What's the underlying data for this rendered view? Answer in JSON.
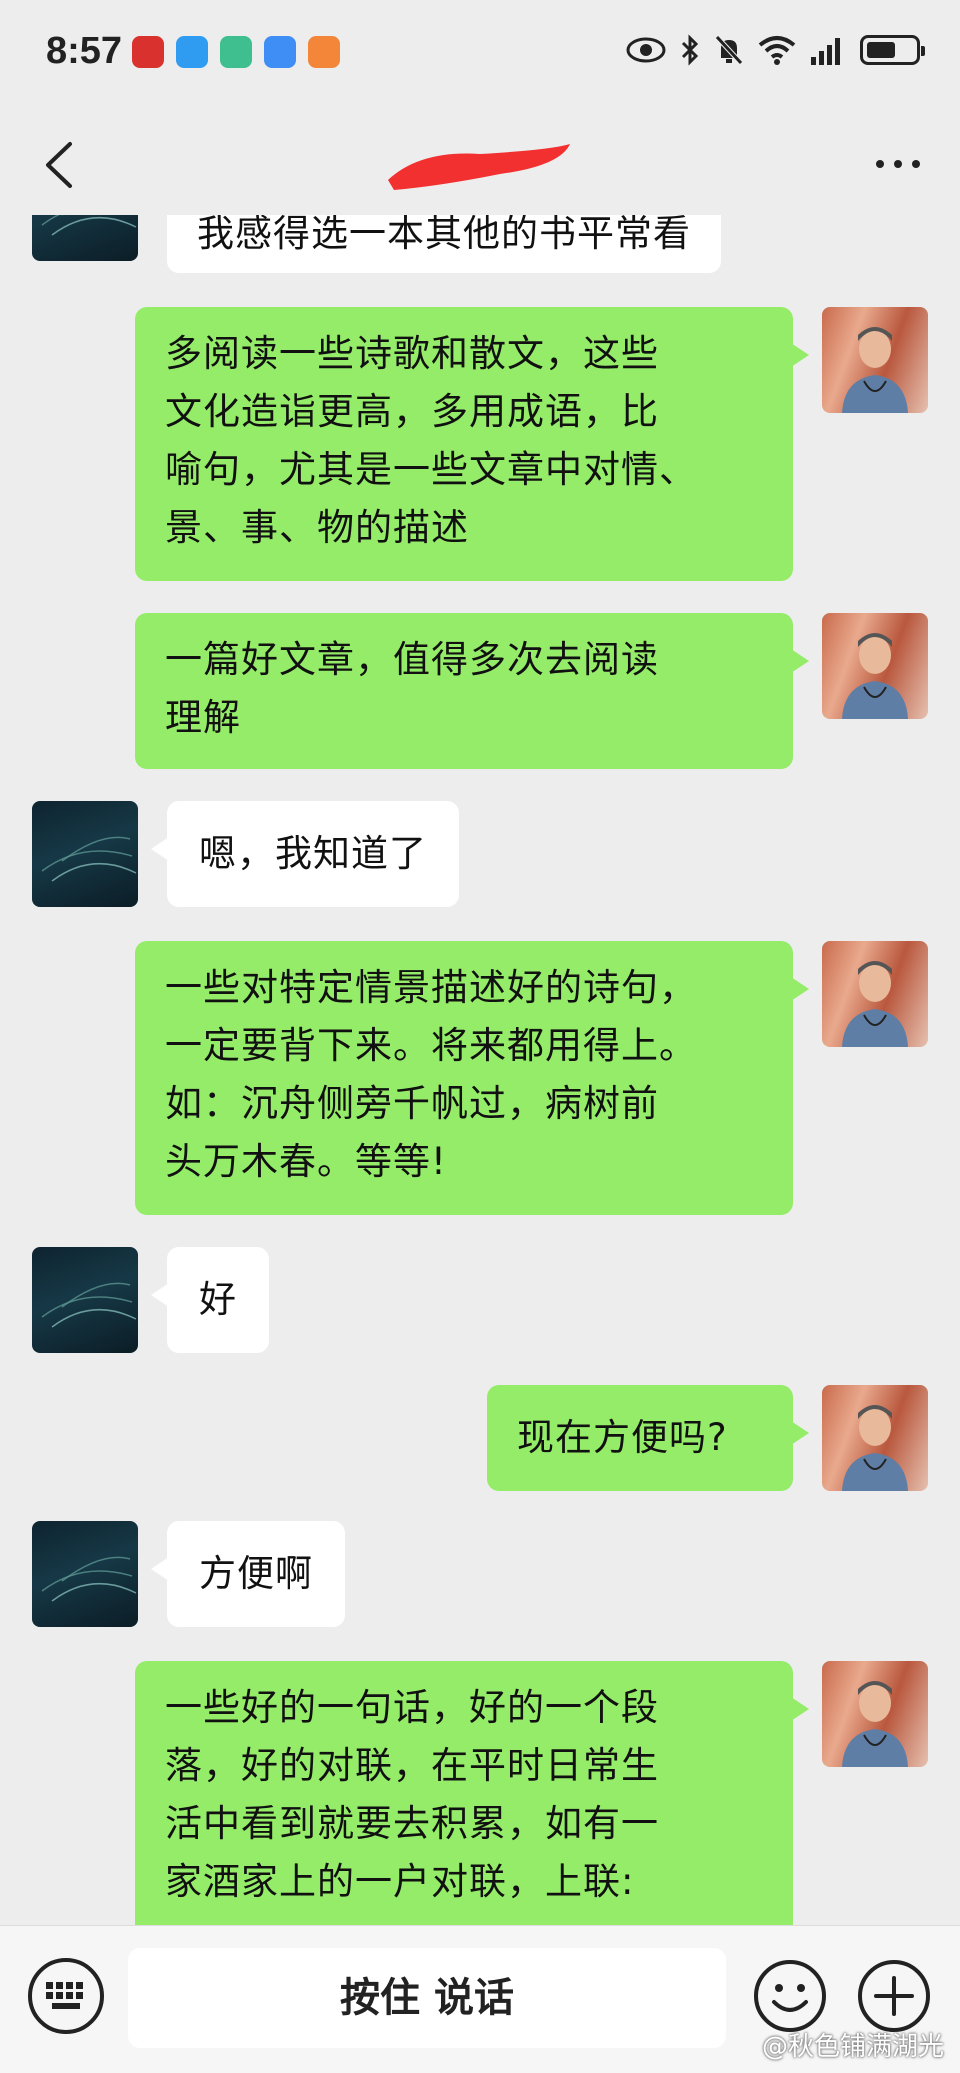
{
  "status_bar": {
    "time": "8:57"
  },
  "header": {
    "title": ""
  },
  "messages": [
    {
      "side": "left",
      "text": "我感得选一本其他的书平常看"
    },
    {
      "side": "right",
      "lines": [
        "多阅读一些诗歌和散文，这些",
        "文化造诣更高，多用成语，比",
        "喻句，尤其是一些文章中对情、",
        "景、事、物的描述"
      ]
    },
    {
      "side": "right",
      "lines": [
        "一篇好文章，值得多次去阅读",
        "理解"
      ]
    },
    {
      "side": "left",
      "text": "嗯，我知道了"
    },
    {
      "side": "right",
      "lines": [
        "一些对特定情景描述好的诗句，",
        "一定要背下来。将来都用得上。",
        "如：沉舟侧旁千帆过，病树前",
        "头万木春。等等!"
      ]
    },
    {
      "side": "left",
      "text": "好"
    },
    {
      "side": "right",
      "text": "现在方便吗?"
    },
    {
      "side": "left",
      "text": "方便啊"
    },
    {
      "side": "right",
      "lines": [
        "一些好的一句话，好的一个段",
        "落，好的对联，在平时日常生",
        "活中看到就要去积累，如有一",
        "家酒家上的一户对联，上联:"
      ]
    }
  ],
  "input_bar": {
    "hold_to_talk": "按住 说话"
  },
  "watermark": "@秋色铺满湖光",
  "colors": {
    "bubble_self": "#95ec69",
    "bubble_other": "#ffffff",
    "background": "#ededed"
  }
}
